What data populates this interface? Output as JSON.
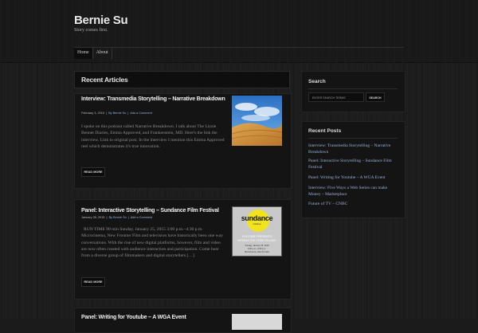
{
  "site": {
    "title": "Bernie Su",
    "tagline": "Story comes first."
  },
  "nav": [
    {
      "label": "Home"
    },
    {
      "label": "About"
    }
  ],
  "main": {
    "section_title": "Recent Articles",
    "posts": [
      {
        "title": "Interview: Transmedia Storytelling – Narrative Breakdown",
        "date": "February 3, 2015",
        "author": "By Bernie Su",
        "comment": "Add a Comment",
        "excerpt": "I spoke on this podcast called Narrative Breakdown. I talk about The Lizzie Bennet Diaries, Emma Approved, and Frankenstein, MD. Here's the link the interview. Link to original post. In the interview I mention this Emma Approved reel which demonstrates it's true innovation.",
        "read_more": "READ MORE",
        "thumb": "desert-sky-icon"
      },
      {
        "title": "Panel: Interactive Storytelling – Sundance Film Festival",
        "date": "January 28, 2015",
        "author": "By Bernie Su",
        "comment": "Add a Comment",
        "excerpt": "RUN TIME 90 min Sunday, January 25, 2015 3:00 p.m.–4:30 p.m. Microcinema, New Frontier Film and television have historically been one way conversations. With the rise of new digital platforms, however, film and video are now often created with audience interaction and participation. Come hear from a diverse group of filmmakers and digital storytellers […]",
        "read_more": "READ MORE",
        "thumb": "sundance-logo-icon",
        "thumb_text": {
          "brand": "sundance",
          "sub": "institute",
          "line1": "YOUTUBE PRESENTS",
          "line2": "INTERACTIVE STORYTELLING",
          "line3": "Sunday, January 25, 2015",
          "line4": "3:00 p.m.–4:30 p.m.",
          "line5": "Microcinema, New Frontier"
        }
      },
      {
        "title": "Panel: Writing for Youtube – A WGA Event"
      }
    ]
  },
  "sidebar": {
    "search": {
      "title": "Search",
      "placeholder": "ENTER SEARCH TERMS",
      "button": "SEARCH"
    },
    "recent_posts": {
      "title": "Recent Posts",
      "items": [
        "Interview: Transmedia Storytelling – Narrative Breakdown",
        "Panel: Interactive Storytelling – Sundance Film Festival",
        "Panel: Writing for Youtube – A WGA Event",
        "Interview: Five Ways a Web Series can make Money – Marketplace",
        "Future of TV – CNBC"
      ]
    }
  },
  "colors": {
    "link": "#9ab3d8",
    "sundance_yellow": "#f2e41c"
  }
}
